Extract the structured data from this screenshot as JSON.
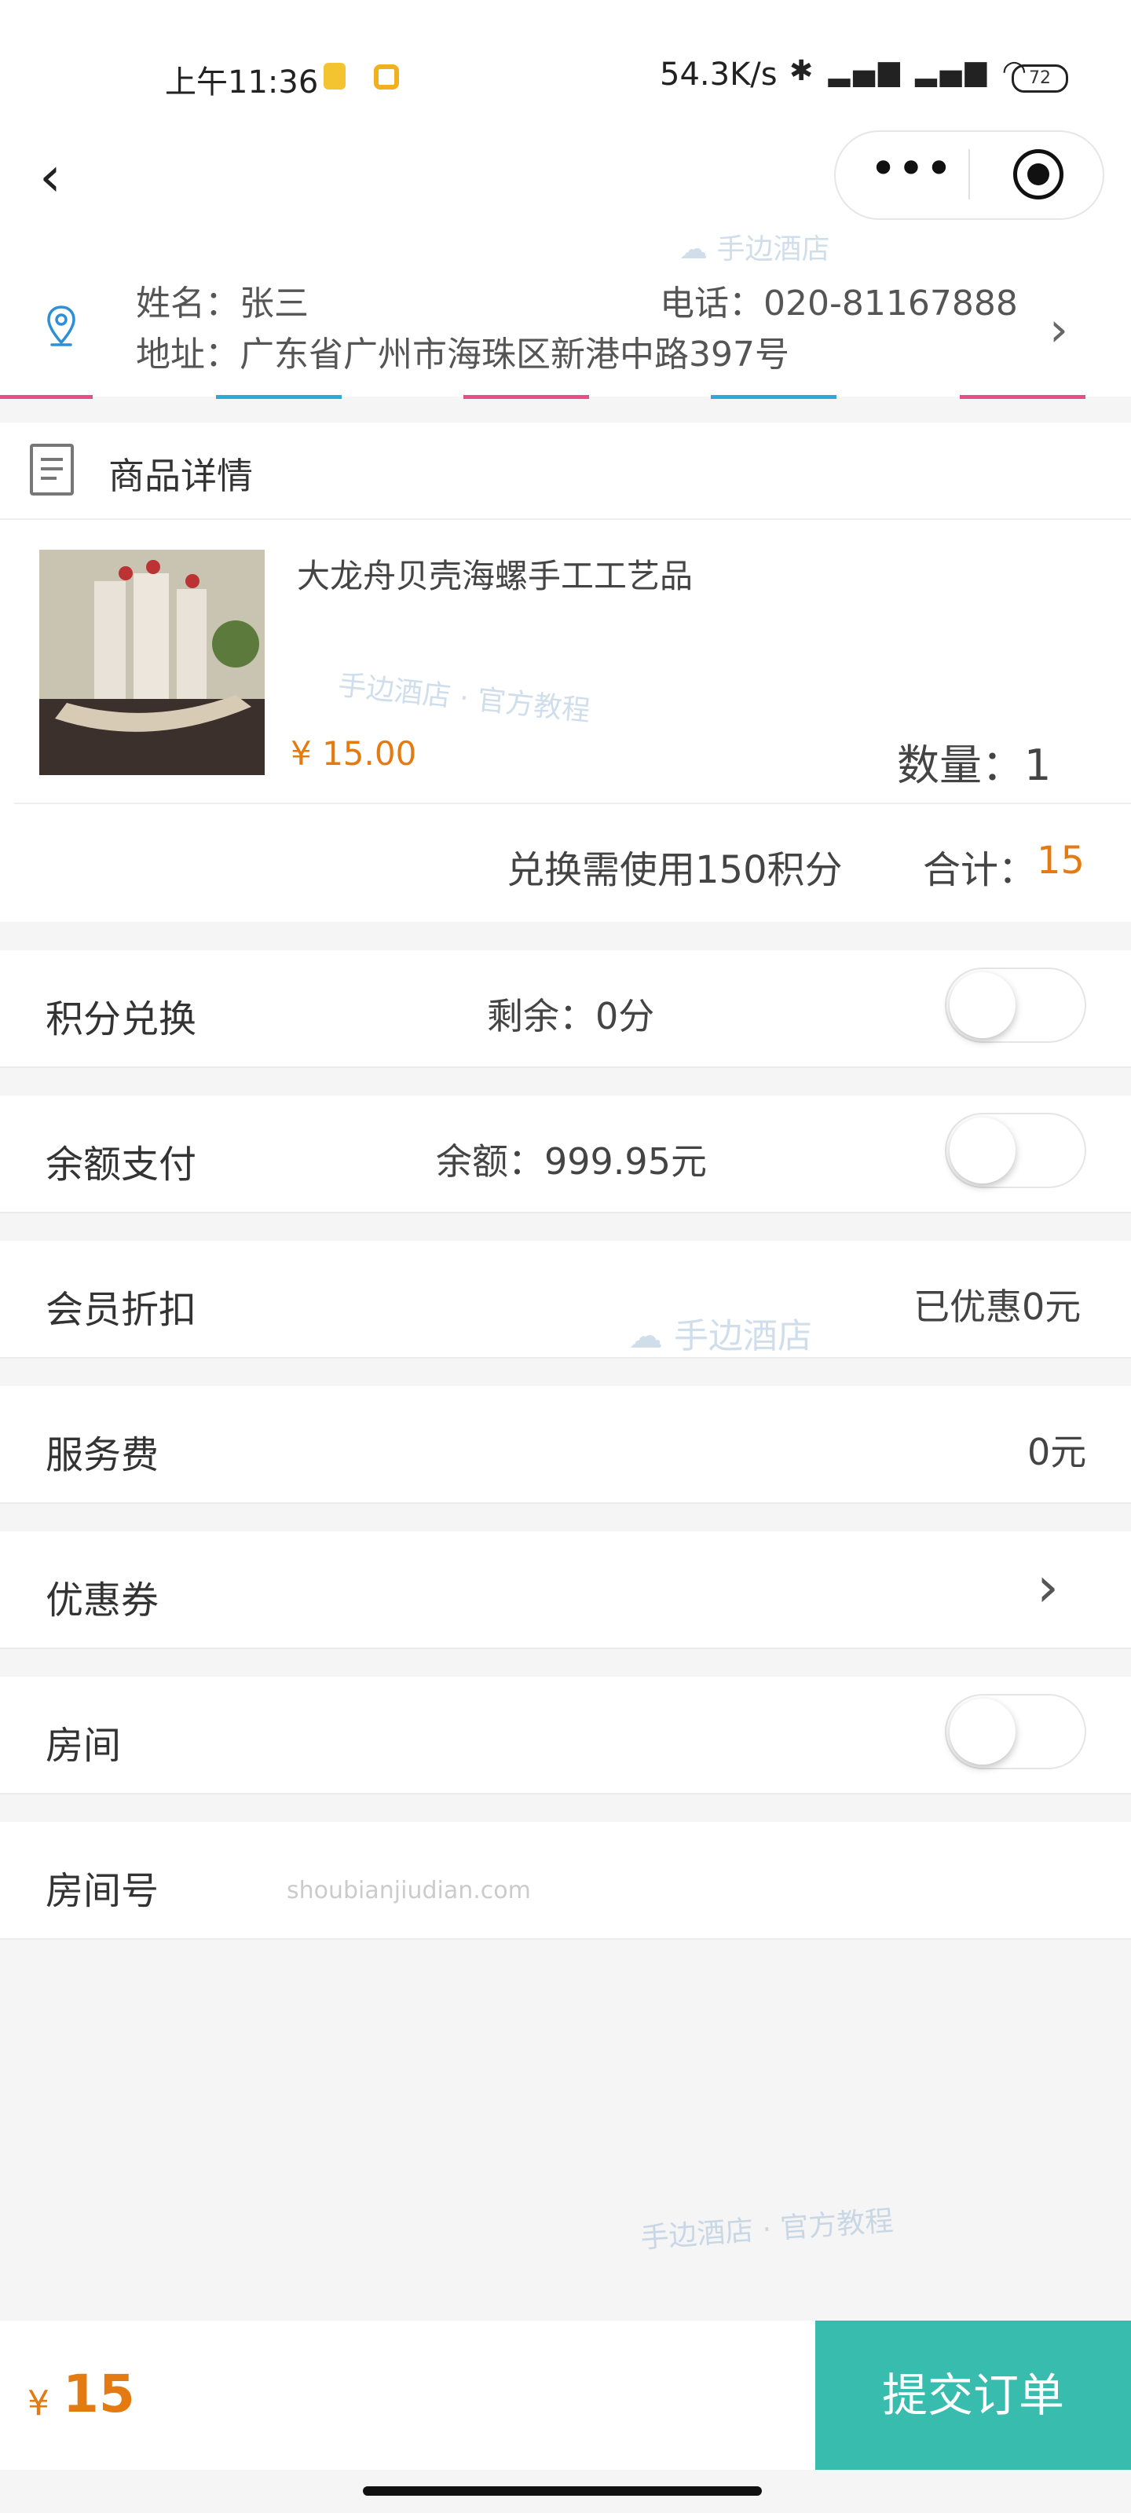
{
  "status_bar": {
    "time": "上午11:36",
    "network_speed": "54.3K/s",
    "battery": "72"
  },
  "address": {
    "name": "姓名：张三",
    "phone": "电话：020-81167888",
    "address": "地址：广东省广州市海珠区新港中路397号"
  },
  "goods": {
    "header": "商品详情",
    "title": "大龙舟贝壳海螺手工工艺品",
    "price": "¥ 15.00",
    "quantity": "数量：1",
    "points_needed": "兑换需使用150积分",
    "total_label": "合计：",
    "total_value": "15"
  },
  "rows": {
    "points": {
      "label": "积分兑换",
      "info": "剩余：0分"
    },
    "balance": {
      "label": "余额支付",
      "info": "余额：999.95元"
    },
    "member": {
      "label": "会员折扣",
      "info": "已优惠0元"
    },
    "service": {
      "label": "服务费",
      "info": "0元"
    },
    "coupon": {
      "label": "优惠券"
    },
    "room": {
      "label": "房间"
    },
    "room_no": {
      "label": "房间号"
    }
  },
  "watermarks": {
    "brand": "手边酒店",
    "tutorial_a": "手边酒店 · 官方教程",
    "domain": "shoubianjiudian.com",
    "tutorial_b": "手边酒店 · 官方教程"
  },
  "footer": {
    "currency": "¥",
    "amount": "15",
    "submit": "提交订单"
  },
  "colors": {
    "accent": "#37bcae",
    "price": "#e37b12"
  }
}
